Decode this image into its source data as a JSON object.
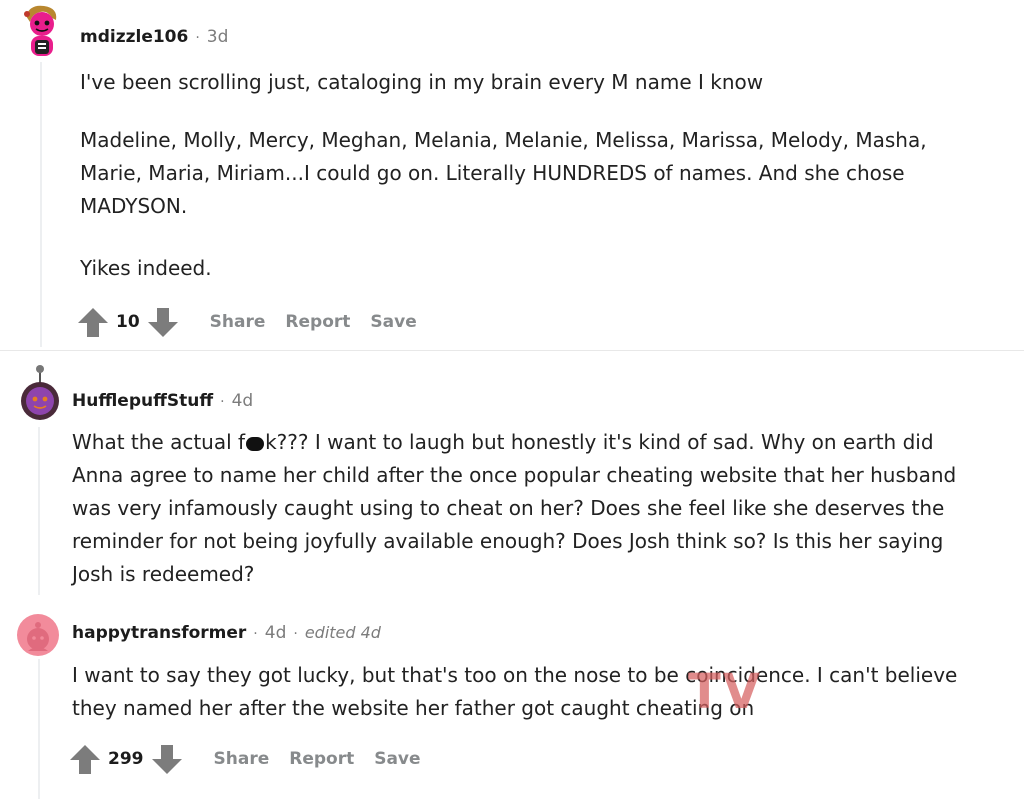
{
  "comments": [
    {
      "username": "mdizzle106",
      "time": "3d",
      "paragraphs": [
        "I've been scrolling just, cataloging in my brain every M name I know",
        "Madeline, Molly, Mercy, Meghan, Melania, Melanie, Melissa, Marissa, Melody, Masha,",
        "Marie, Maria, Miriam...I could go on. Literally HUNDREDS of names. And she chose",
        "MADYSON.",
        "Yikes indeed."
      ],
      "score": "10",
      "actions": {
        "share": "Share",
        "report": "Report",
        "save": "Save"
      },
      "avatar_color": "#e91e8c"
    },
    {
      "username": "HufflepuffStuff",
      "time": "4d",
      "text_before": "What the actual f",
      "text_after": "k??? I want to laugh but honestly it's kind of sad. Why on earth did",
      "lines": [
        "Anna agree to name her child after the once popular cheating website that her husband",
        "was very infamously caught using to cheat on her? Does she feel like she deserves the",
        "reminder for not being joyfully available enough? Does Josh think so? Is this her saying",
        "Josh is redeemed?"
      ],
      "avatar_color": "#8e44ad"
    },
    {
      "username": "happytransformer",
      "time": "4d",
      "edited": "edited 4d",
      "lines": [
        "I want to say they got lucky, but that's too on the nose to be coincidence. I can't believe",
        "they named her after the website her father got caught cheating on"
      ],
      "score": "299",
      "actions": {
        "share": "Share",
        "report": "Report",
        "save": "Save"
      },
      "avatar_color": "#f28b9b"
    }
  ],
  "meta_separator": "·",
  "watermark": "TV"
}
